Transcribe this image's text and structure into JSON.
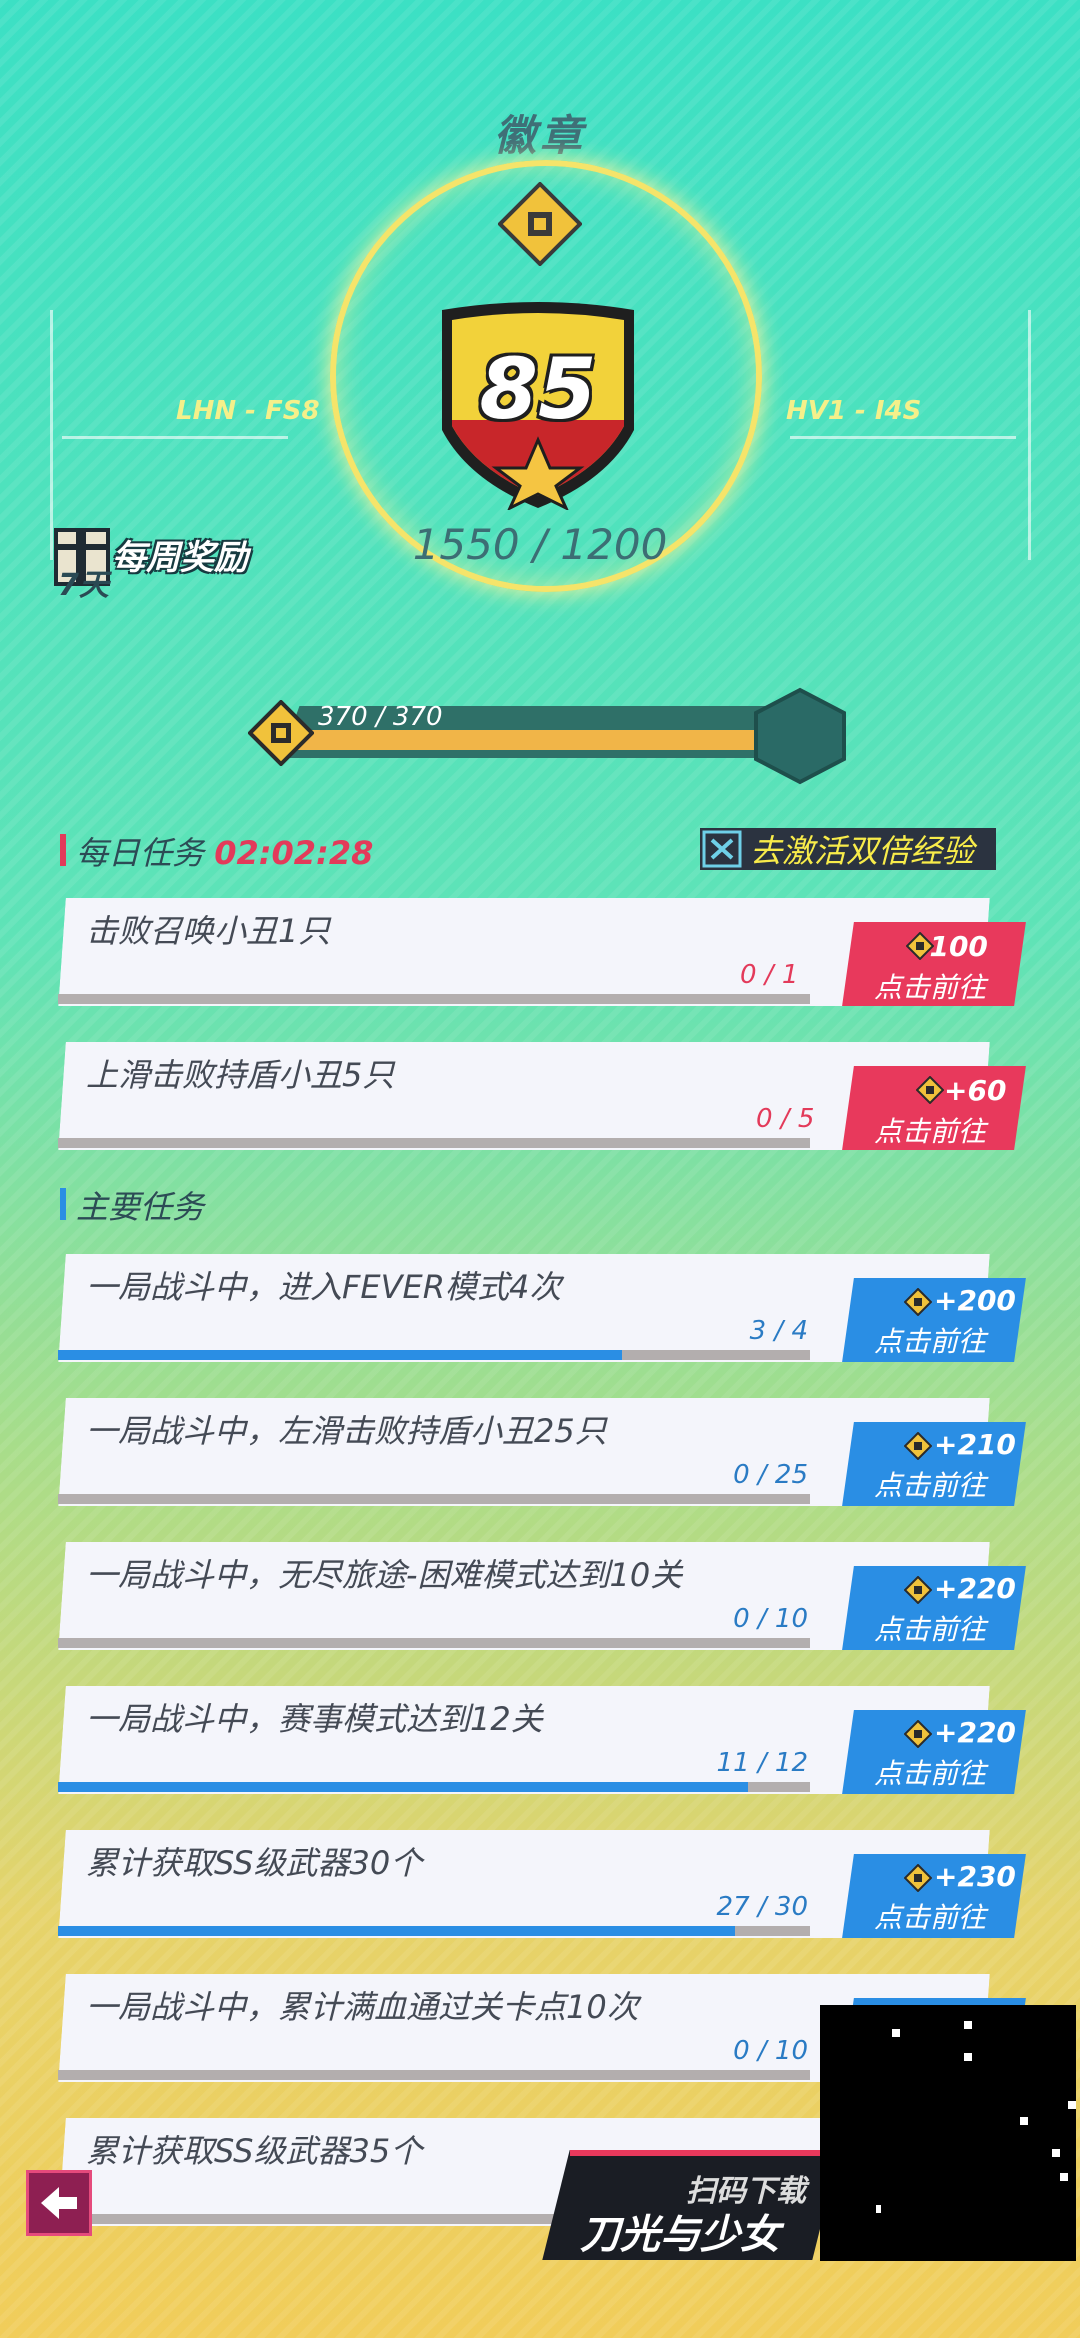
{
  "header": {
    "title": "徽章"
  },
  "badge": {
    "level": "85",
    "score": "1550 / 1200",
    "left_code": "LHN - FS8",
    "right_code": "HV1 - I4S"
  },
  "weekly": {
    "label": "每周奖励",
    "days": "7天"
  },
  "xp": {
    "text": "370 / 370",
    "fraction": 1.0
  },
  "daily": {
    "title": "每日任务",
    "timer": "02:02:28",
    "double_label": "去激活双倍经验",
    "tasks": [
      {
        "title": "击败召唤小丑1只",
        "progress": "0 / 1",
        "fraction": 0,
        "reward": "+100",
        "go": "点击前往"
      },
      {
        "title": "上滑击败持盾小丑5只",
        "progress": "0 / 5",
        "fraction": 0,
        "reward": "+60",
        "go": "点击前往"
      }
    ]
  },
  "main": {
    "title": "主要任务",
    "tasks": [
      {
        "title": "一局战斗中，进入FEVER模式4次",
        "progress": "3 / 4",
        "fraction": 0.75,
        "reward": "+200",
        "go": "点击前往"
      },
      {
        "title": "一局战斗中，左滑击败持盾小丑25只",
        "progress": "0 / 25",
        "fraction": 0,
        "reward": "+210",
        "go": "点击前往"
      },
      {
        "title": "一局战斗中，无尽旅途-困难模式达到10关",
        "progress": "0 / 10",
        "fraction": 0,
        "reward": "+220",
        "go": "点击前往"
      },
      {
        "title": "一局战斗中，赛事模式达到12关",
        "progress": "11 / 12",
        "fraction": 0.917,
        "reward": "+220",
        "go": "点击前往"
      },
      {
        "title": "累计获取SS级武器30个",
        "progress": "27 / 30",
        "fraction": 0.9,
        "reward": "+230",
        "go": "点击前往"
      },
      {
        "title": "一局战斗中，累计满血通过关卡点10次",
        "progress": "0 / 10",
        "fraction": 0,
        "reward": "",
        "go": ""
      },
      {
        "title": "累计获取SS级武器35个",
        "progress": "",
        "fraction": 0,
        "reward": "",
        "go": ""
      }
    ]
  },
  "promo": {
    "line1": "扫码下载",
    "line2": "刀光与少女"
  },
  "colors": {
    "daily_reward": "#e8395c",
    "main_reward": "#2a8ee4",
    "progress_fill": "#2a8ee4",
    "daily_progress": "#e33a5a",
    "main_progress": "#2a7bc4"
  }
}
